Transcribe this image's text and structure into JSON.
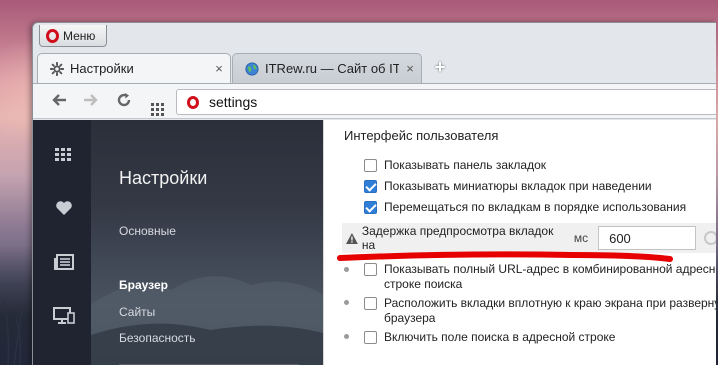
{
  "window": {
    "menu_label": "Меню"
  },
  "tabs": [
    {
      "title": "Настройки",
      "icon": "gear-icon",
      "close": "×",
      "active": true
    },
    {
      "title": "ITRew.ru — Сайт об IT для",
      "icon": "globe-icon",
      "close": "×",
      "active": false
    }
  ],
  "toolbar": {
    "new_tab": "+",
    "address": "settings"
  },
  "sidebar": {
    "title": "Настройки",
    "items": [
      {
        "label": "Основные",
        "active": false
      },
      {
        "label": "Браузер",
        "active": true
      },
      {
        "label": "Сайты",
        "active": false
      },
      {
        "label": "Безопасность",
        "active": false
      }
    ]
  },
  "content": {
    "section_title": "Интерфейс пользователя",
    "options": [
      {
        "label": "Показывать панель закладок",
        "checked": false
      },
      {
        "label": "Показывать миниатюры вкладок при наведении",
        "checked": true
      },
      {
        "label": "Перемещаться по вкладкам в порядке использования",
        "checked": true
      }
    ],
    "delay": {
      "label": "Задержка предпросмотра вкладок на",
      "unit": "мс",
      "value": "600"
    },
    "advanced_options": [
      {
        "label_line1": "Показывать полный URL-адрес в комбинированной адресной",
        "label_line2": "строке поиска",
        "checked": false
      },
      {
        "label_line1": "Расположить вкладки вплотную к краю экрана при развернут",
        "label_line2": "браузера",
        "checked": false
      },
      {
        "label_line1": "Включить поле поиска в адресной строке",
        "label_line2": "",
        "checked": false
      }
    ]
  },
  "colors": {
    "opera_red": "#d10f1b",
    "checkbox_blue": "#2f7fd9",
    "annotation_red": "#e60000",
    "sidebar_dark": "#1f2430"
  }
}
